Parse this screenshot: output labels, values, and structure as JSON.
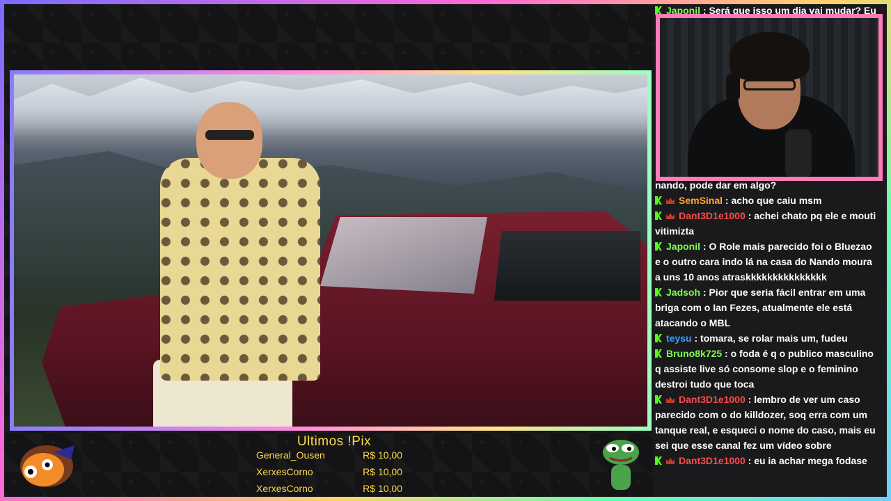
{
  "chat": {
    "messages": [
      {
        "user": "Japonil",
        "color": "green",
        "crown": false,
        "text": "Será que isso um dia vai mudar? Eu"
      },
      {
        "user": "",
        "color": "",
        "crown": false,
        "text": "nando, pode dar em algo?"
      },
      {
        "user": "SemSinal",
        "color": "orange",
        "crown": true,
        "text": "acho que caiu msm"
      },
      {
        "user": "Dant3D1e1000",
        "color": "red",
        "crown": true,
        "text": "achei chato pq ele e mouti vitimizta"
      },
      {
        "user": "Japonil",
        "color": "green",
        "crown": false,
        "text": "O Role mais parecido foi o Bluezao e o outro cara indo lá na casa do Nando moura a uns 10 anos atraskkkkkkkkkkkkkkk"
      },
      {
        "user": "Jadsoh",
        "color": "green",
        "crown": false,
        "text": "Pior que seria fácil entrar em uma briga com o Ian Fezes, atualmente ele está atacando o MBL"
      },
      {
        "user": "teysu",
        "color": "blue",
        "crown": false,
        "text": "tomara, se rolar mais um, fudeu"
      },
      {
        "user": "Bruno8k725",
        "color": "green",
        "crown": false,
        "text": "o foda é q o publico masculino q assiste live só consome slop e o feminino destroi tudo que toca"
      },
      {
        "user": "Dant3D1e1000",
        "color": "red",
        "crown": true,
        "text": "lembro de ver um caso parecido com o do killdozer, soq erra com um tanque real, e esqueci o nome do caso, mais eu sei que esse canal fez um vídeo sobre"
      },
      {
        "user": "Dant3D1e1000",
        "color": "red",
        "crown": true,
        "text": "eu ia achar mega fodase"
      }
    ]
  },
  "pix": {
    "title": "Ultimos !Pix",
    "rows": [
      {
        "name": "General_Ousen",
        "amount": "R$ 10,00"
      },
      {
        "name": "XerxesCorno",
        "amount": "R$ 10,00"
      },
      {
        "name": "XerxesCorno",
        "amount": "R$ 10,00"
      }
    ]
  },
  "colors": {
    "badge": "#53fc18",
    "pix": "#ffd84a",
    "webcam_border": "#ff7ab8"
  }
}
